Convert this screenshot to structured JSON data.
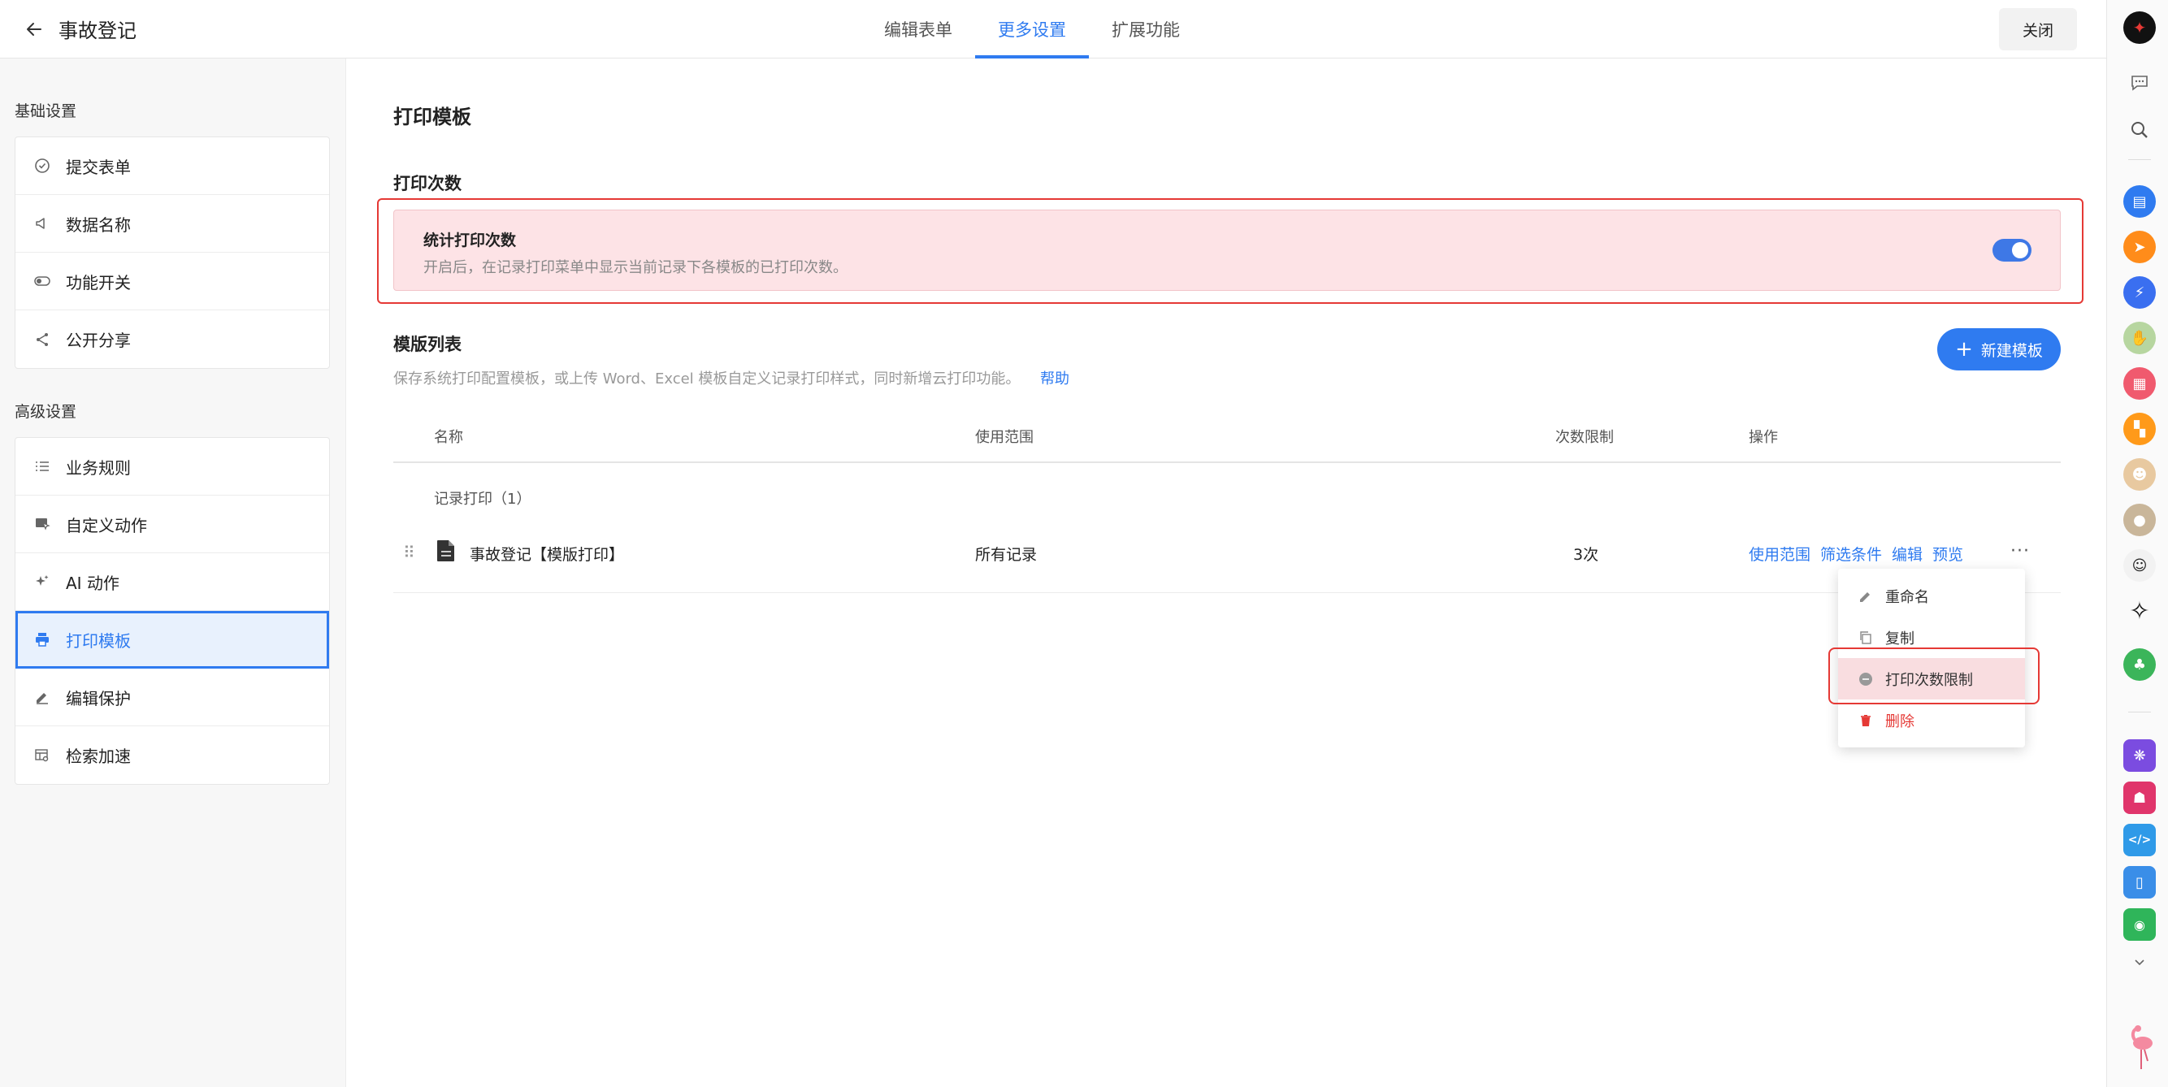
{
  "header": {
    "title": "事故登记",
    "tabs": [
      {
        "label": "编辑表单"
      },
      {
        "label": "更多设置"
      },
      {
        "label": "扩展功能"
      }
    ],
    "close_label": "关闭"
  },
  "sidebar": {
    "basic_title": "基础设置",
    "basic_items": [
      {
        "label": "提交表单",
        "icon": "check-circle-icon"
      },
      {
        "label": "数据名称",
        "icon": "megaphone-icon"
      },
      {
        "label": "功能开关",
        "icon": "toggle-icon"
      },
      {
        "label": "公开分享",
        "icon": "share-icon"
      }
    ],
    "advanced_title": "高级设置",
    "advanced_items": [
      {
        "label": "业务规则",
        "icon": "list-icon"
      },
      {
        "label": "自定义动作",
        "icon": "cursor-icon"
      },
      {
        "label": "AI 动作",
        "icon": "sparkle-icon"
      },
      {
        "label": "打印模板",
        "icon": "printer-icon"
      },
      {
        "label": "编辑保护",
        "icon": "pen-icon"
      },
      {
        "label": "检索加速",
        "icon": "table-search-icon"
      }
    ]
  },
  "main": {
    "title": "打印模板",
    "print_count": {
      "section_title": "打印次数",
      "card_title": "统计打印次数",
      "card_desc": "开启后，在记录打印菜单中显示当前记录下各模板的已打印次数。",
      "enabled": true
    },
    "template_list": {
      "title": "模版列表",
      "desc": "保存系统打印配置模板，或上传 Word、Excel 模板自定义记录打印样式，同时新增云打印功能。",
      "help": "帮助",
      "new_button": "新建模板",
      "new_button_icon": "+",
      "columns": [
        "名称",
        "使用范围",
        "次数限制",
        "操作"
      ],
      "group_label": "记录打印（1）",
      "rows": [
        {
          "name": "事故登记【模版打印】",
          "scope": "所有记录",
          "limit": "3次",
          "ops": [
            "使用范围",
            "筛选条件",
            "编辑",
            "预览"
          ]
        }
      ]
    },
    "dropdown": {
      "items": [
        {
          "label": "重命名",
          "icon": "pencil-icon"
        },
        {
          "label": "复制",
          "icon": "copy-icon"
        },
        {
          "label": "打印次数限制",
          "icon": "limit-icon"
        },
        {
          "label": "删除",
          "icon": "trash-icon"
        }
      ]
    }
  },
  "colors": {
    "accent": "#2f7bf0",
    "danger": "#e53935",
    "highlight_bg": "#fde3e6"
  }
}
